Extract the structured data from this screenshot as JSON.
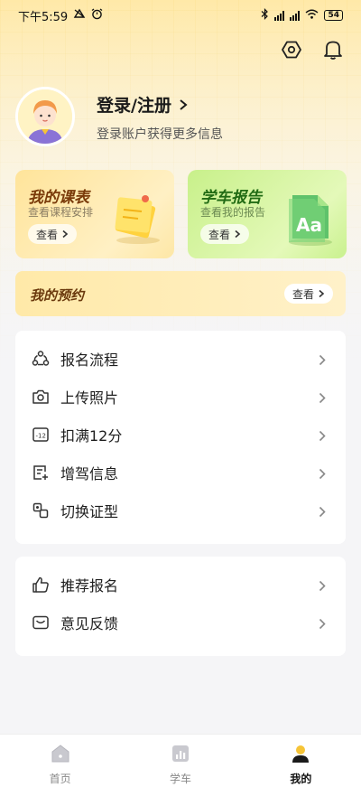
{
  "status_bar": {
    "time": "下午5:59",
    "battery": "54"
  },
  "profile": {
    "login_label": "登录/注册",
    "subtitle": "登录账户获得更多信息"
  },
  "cards": {
    "schedule": {
      "title": "我的课表",
      "subtitle": "查看课程安排",
      "button": "查看"
    },
    "report": {
      "title": "学车报告",
      "subtitle": "查看我的报告",
      "button": "查看"
    }
  },
  "reservation": {
    "title": "我的预约",
    "button": "查看"
  },
  "menu_one": {
    "items": [
      {
        "label": "报名流程",
        "icon": "process-icon"
      },
      {
        "label": "上传照片",
        "icon": "camera-icon"
      },
      {
        "label": "扣满12分",
        "icon": "points-icon"
      },
      {
        "label": "增驾信息",
        "icon": "license-add-icon"
      },
      {
        "label": "切换证型",
        "icon": "switch-icon"
      }
    ]
  },
  "menu_two": {
    "items": [
      {
        "label": "推荐报名",
        "icon": "thumbs-up-icon"
      },
      {
        "label": "意见反馈",
        "icon": "feedback-icon"
      }
    ]
  },
  "tabbar": {
    "tabs": [
      {
        "label": "首页",
        "icon": "home-icon",
        "active": false
      },
      {
        "label": "学车",
        "icon": "chart-icon",
        "active": false
      },
      {
        "label": "我的",
        "icon": "user-icon",
        "active": true
      }
    ]
  },
  "colors": {
    "accent": "#f6c437",
    "schedule_card": "#ffe49a",
    "report_card": "#c8f08a"
  }
}
